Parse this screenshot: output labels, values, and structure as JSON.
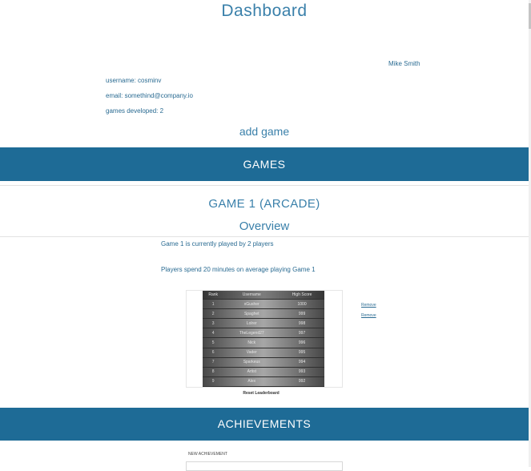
{
  "header": {
    "title": "Dashboard"
  },
  "profile": {
    "name": "Mike Smith",
    "username": "username: cosminv",
    "email": "email: somethind@company.io",
    "games_developed": "games developed: 2",
    "add_game": "add game"
  },
  "games_section": {
    "heading": "GAMES",
    "game_title": "GAME 1 (ARCADE)",
    "overview_heading": "Overview",
    "stat_players": "Game 1 is currently played by 2 players",
    "stat_time": "Players spend 20 minutes on average playing Game 1"
  },
  "leaderboard": {
    "columns": [
      "Rank",
      "Username",
      "High Score"
    ],
    "rows": [
      [
        "1",
        "xGusher",
        "1000"
      ],
      [
        "2",
        "Spaghet",
        "999"
      ],
      [
        "3",
        "Lolrer",
        "998"
      ],
      [
        "4",
        "TheLegend27",
        "997"
      ],
      [
        "5",
        "Nick",
        "996"
      ],
      [
        "6",
        "Vader",
        "995"
      ],
      [
        "7",
        "Sparkeus",
        "994"
      ],
      [
        "8",
        "Artist",
        "993"
      ],
      [
        "9",
        "Alex",
        "992"
      ]
    ],
    "remove_labels": [
      "Remove",
      "Remove"
    ],
    "reset_label": "Reset Leaderboard"
  },
  "achievements": {
    "heading": "ACHIEVEMENTS",
    "new_label": "NEW ACHIEVEMENT",
    "input_value": ""
  }
}
